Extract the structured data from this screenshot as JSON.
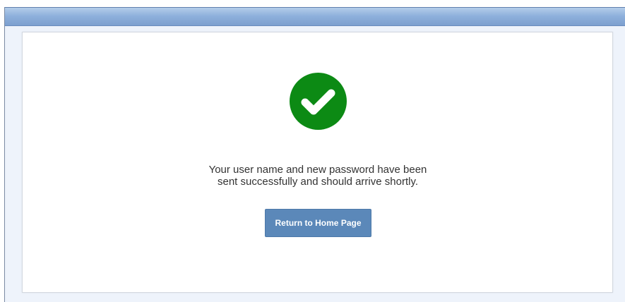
{
  "header": {
    "bar_color": "#8fb1dc"
  },
  "confirmation": {
    "icon": "checkmark-circle-icon",
    "icon_color": "#0c8a14",
    "message": "Your user name and new password have been sent successfully and should arrive shortly."
  },
  "actions": {
    "return_home_label": "Return to Home Page",
    "button_color": "#5b88b9"
  }
}
